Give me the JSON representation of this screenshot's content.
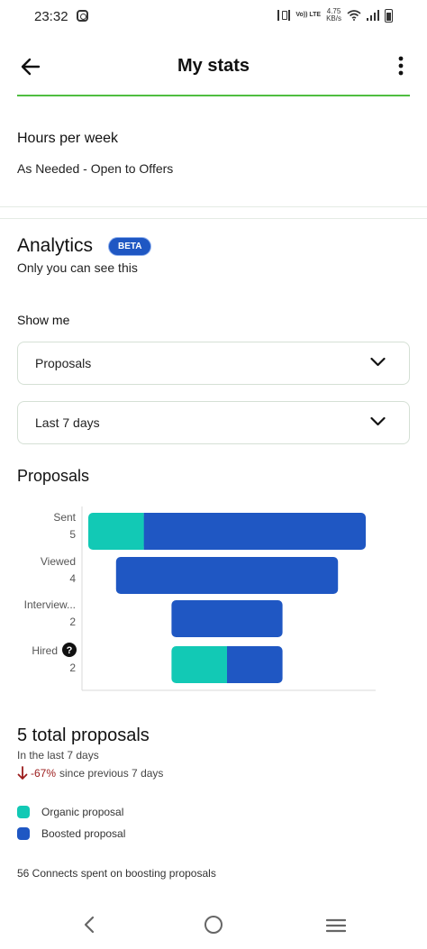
{
  "status_bar": {
    "time": "23:32",
    "network_label": "Vo)) LTE",
    "speed_value": "4.75",
    "speed_unit": "KB/s"
  },
  "header": {
    "title": "My stats"
  },
  "hours": {
    "title": "Hours per week",
    "value": "As Needed - Open to Offers"
  },
  "analytics": {
    "title": "Analytics",
    "badge": "BETA",
    "subtitle": "Only you can see this",
    "show_me_label": "Show me",
    "metric_select": "Proposals",
    "period_select": "Last 7 days"
  },
  "proposals_section": {
    "title": "Proposals"
  },
  "colors": {
    "organic": "#12c9b5",
    "boosted": "#1f57c3",
    "accent_green": "#14a800",
    "decline_red": "#9b1b1b"
  },
  "chart_data": {
    "type": "bar",
    "orientation": "horizontal-funnel",
    "categories": [
      "Sent",
      "Viewed",
      "Interview...",
      "Hired"
    ],
    "totals": [
      5,
      4,
      2,
      2
    ],
    "series": [
      {
        "name": "Organic proposal",
        "values": [
          1,
          0,
          0,
          1
        ]
      },
      {
        "name": "Boosted proposal",
        "values": [
          4,
          4,
          2,
          1
        ]
      }
    ],
    "hired_help_icon": "question-circle-icon"
  },
  "summary": {
    "title": "5 total proposals",
    "subtitle": "In the last 7 days",
    "change_pct": "-67%",
    "change_text": "since previous 7 days"
  },
  "legend": [
    {
      "label": "Organic proposal",
      "color": "#12c9b5"
    },
    {
      "label": "Boosted proposal",
      "color": "#1f57c3"
    }
  ],
  "connects_note": "56 Connects spent on boosting proposals"
}
